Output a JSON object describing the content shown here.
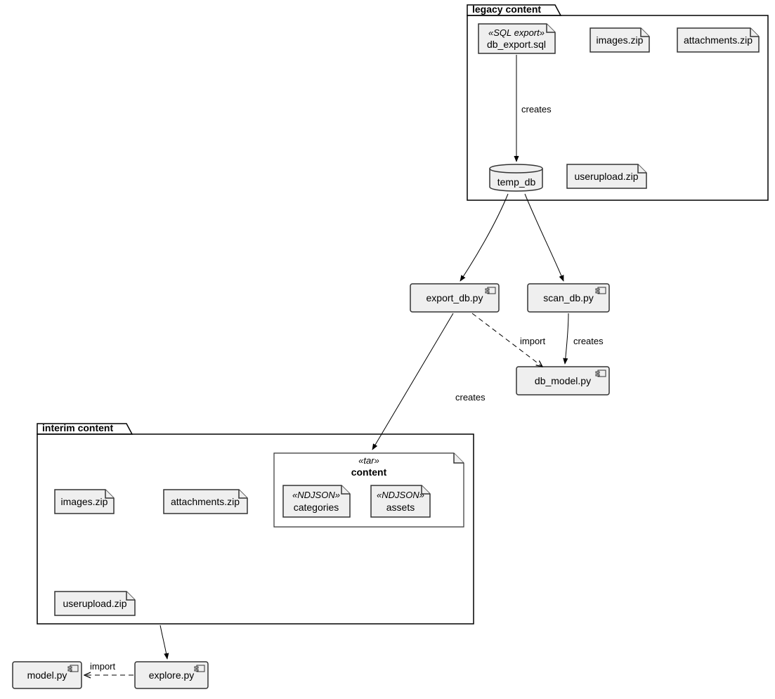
{
  "packages": {
    "legacy": {
      "title": "legacy content"
    },
    "interim": {
      "title": "interim content"
    }
  },
  "nodes": {
    "db_export": {
      "stereo": "«SQL export»",
      "label": "db_export.sql"
    },
    "images1": {
      "label": "images.zip"
    },
    "attachments1": {
      "label": "attachments.zip"
    },
    "userupload1": {
      "label": "userupload.zip"
    },
    "temp_db": {
      "label": "temp_db"
    },
    "export_db": {
      "label": "export_db.py"
    },
    "scan_db": {
      "label": "scan_db.py"
    },
    "db_model": {
      "label": "db_model.py"
    },
    "content": {
      "stereo": "«tar»",
      "label": "content"
    },
    "categories": {
      "stereo": "«NDJSON»",
      "label": "categories"
    },
    "assets": {
      "stereo": "«NDJSON»",
      "label": "assets"
    },
    "images2": {
      "label": "images.zip"
    },
    "attachments2": {
      "label": "attachments.zip"
    },
    "userupload2": {
      "label": "userupload.zip"
    },
    "explore": {
      "label": "explore.py"
    },
    "model": {
      "label": "model.py"
    }
  },
  "edges": {
    "db_export_to_temp_db": "creates",
    "scan_db_to_db_model": "creates",
    "export_db_to_db_model": "import",
    "export_db_to_content": "creates",
    "explore_to_model": "import"
  }
}
